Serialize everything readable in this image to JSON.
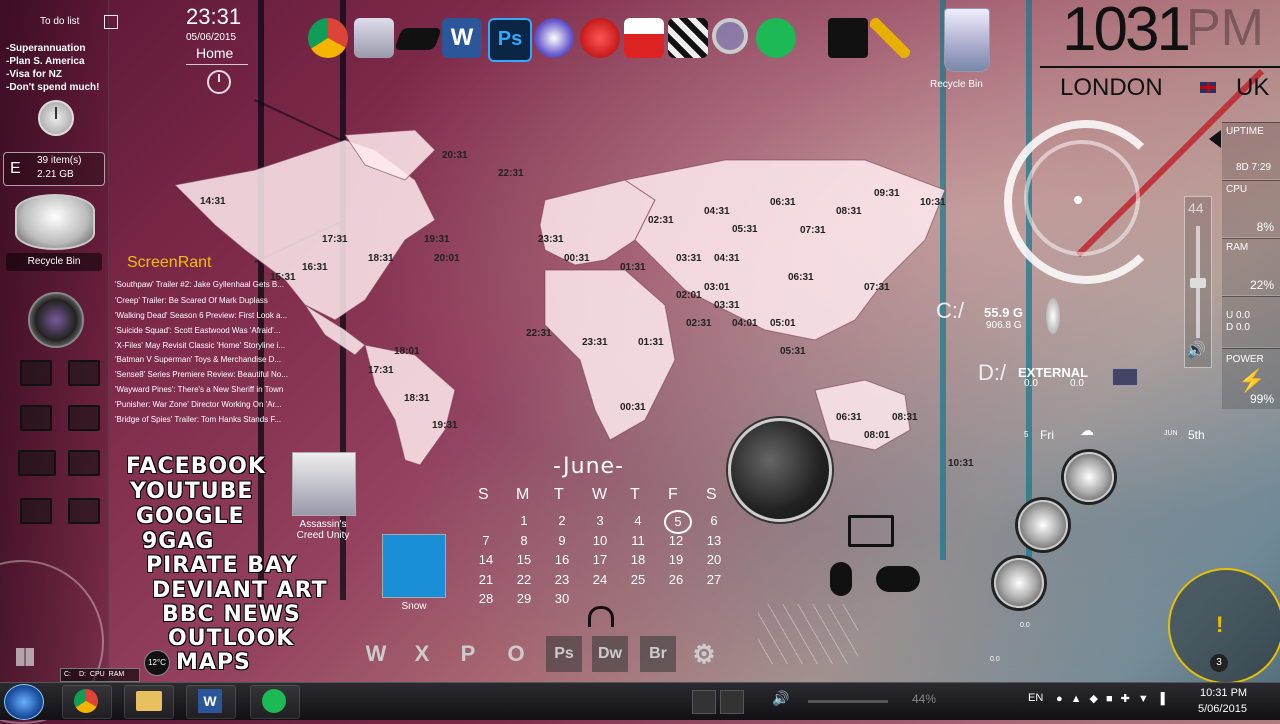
{
  "todo": {
    "title": "To do list",
    "items": [
      "-Superannuation",
      "-Plan S. America",
      "-Visa for NZ",
      "-Don't spend much!"
    ]
  },
  "recycle_widget": {
    "drive": "E",
    "count": "39 item(s)",
    "size": "2.21 GB",
    "label": "Recycle Bin"
  },
  "top_clock": {
    "time": "23:31",
    "date": "05/06/2015",
    "home": "Home"
  },
  "desktop_recycle": {
    "label": "Recycle Bin"
  },
  "world_clock": {
    "zones": [
      "20:31",
      "22:31",
      "14:31",
      "17:31",
      "19:31",
      "18:31",
      "20:01",
      "16:31",
      "15:31",
      "23:31",
      "00:31",
      "01:31",
      "02:31",
      "04:31",
      "05:31",
      "06:31",
      "07:31",
      "08:31",
      "09:31",
      "10:31",
      "03:31",
      "04:31",
      "06:31",
      "03:01",
      "02:01",
      "03:31",
      "04:01",
      "05:01",
      "05:31",
      "07:31",
      "02:31",
      "01:31",
      "22:31",
      "23:31",
      "00:31",
      "18:01",
      "17:31",
      "18:31",
      "19:31",
      "06:31",
      "08:31",
      "08:01",
      "10:31"
    ]
  },
  "screenrant": {
    "title": "ScreenRant",
    "items": [
      "'Southpaw' Trailer #2: Jake Gyllenhaal Gets B...",
      "'Creep' Trailer: Be Scared Of Mark Duplass",
      "'Walking Dead' Season 6 Preview: First Look a...",
      "'Suicide Squad': Scott Eastwood Was 'Afraid'...",
      "'X-Files' May Revisit Classic 'Home' Storyline i...",
      "'Batman V Superman' Toys & Merchandise D...",
      "'Sense8' Series Premiere Review: Beautiful No...",
      "'Wayward Pines': There's a New Sheriff in Town",
      "'Punisher: War Zone' Director Working On 'Ar...",
      "'Bridge of Spies' Trailer: Tom Hanks Stands F..."
    ]
  },
  "links": [
    "FACEBOOK",
    "YOUTUBE",
    "GOOGLE",
    "9GAG",
    "PIRATE BAY",
    "DEVIANT ART",
    "BBC NEWS",
    "OUTLOOK",
    "MAPS"
  ],
  "desktop_icons": {
    "assassins": "Assassin's\nCreed Unity",
    "snow": "Snow"
  },
  "calendar": {
    "month": "-June-",
    "weekdays": [
      "S",
      "M",
      "T",
      "W",
      "T",
      "F",
      "S"
    ],
    "days": [
      [
        "",
        "1",
        "2",
        "3",
        "4",
        "5",
        "6"
      ],
      [
        "7",
        "8",
        "9",
        "10",
        "11",
        "12",
        "13"
      ],
      [
        "14",
        "15",
        "16",
        "17",
        "18",
        "19",
        "20"
      ],
      [
        "21",
        "22",
        "23",
        "24",
        "25",
        "26",
        "27"
      ],
      [
        "28",
        "29",
        "30",
        "",
        "",
        "",
        ""
      ]
    ],
    "today": "5"
  },
  "bottom_apps": [
    "W",
    "X",
    "P",
    "O",
    "Ps",
    "Dw",
    "Br"
  ],
  "big_clock": {
    "time": "1031",
    "ampm": "PM",
    "city": "LONDON",
    "country": "UK"
  },
  "meters": {
    "uptime_label": "UPTIME",
    "uptime": "8D 7:29",
    "cpu_label": "CPU",
    "cpu": "8%",
    "ram_label": "RAM",
    "ram": "22%",
    "up": "U 0.0",
    "down": "D 0.0",
    "power_label": "POWER",
    "power": "99%"
  },
  "volume_level": "44",
  "drives": {
    "c_label": "C:/",
    "c_free": "55.9 G",
    "c_total": "906.8 G",
    "d_label": "D:/",
    "d_name": "EXTERNAL",
    "d_a": "0.0",
    "d_b": "0.0"
  },
  "weather": {
    "day": "Fri",
    "date": "5th",
    "num1": "5",
    "num2": "JUN"
  },
  "temp": "12°C",
  "sysbar": {
    "c": "C:",
    "d": "D:",
    "cpu": "CPU",
    "ram": "RAM"
  },
  "misc_vals": {
    "v1": "0.0",
    "v2": "0.0",
    "compass_num": "3"
  },
  "taskbar": {
    "volume_pct": "44%",
    "lang": "EN",
    "time": "10:31 PM",
    "date": "5/06/2015"
  },
  "colors": {
    "accent_yellow": "#e8c000",
    "taskbar": "#1a1a1e"
  }
}
